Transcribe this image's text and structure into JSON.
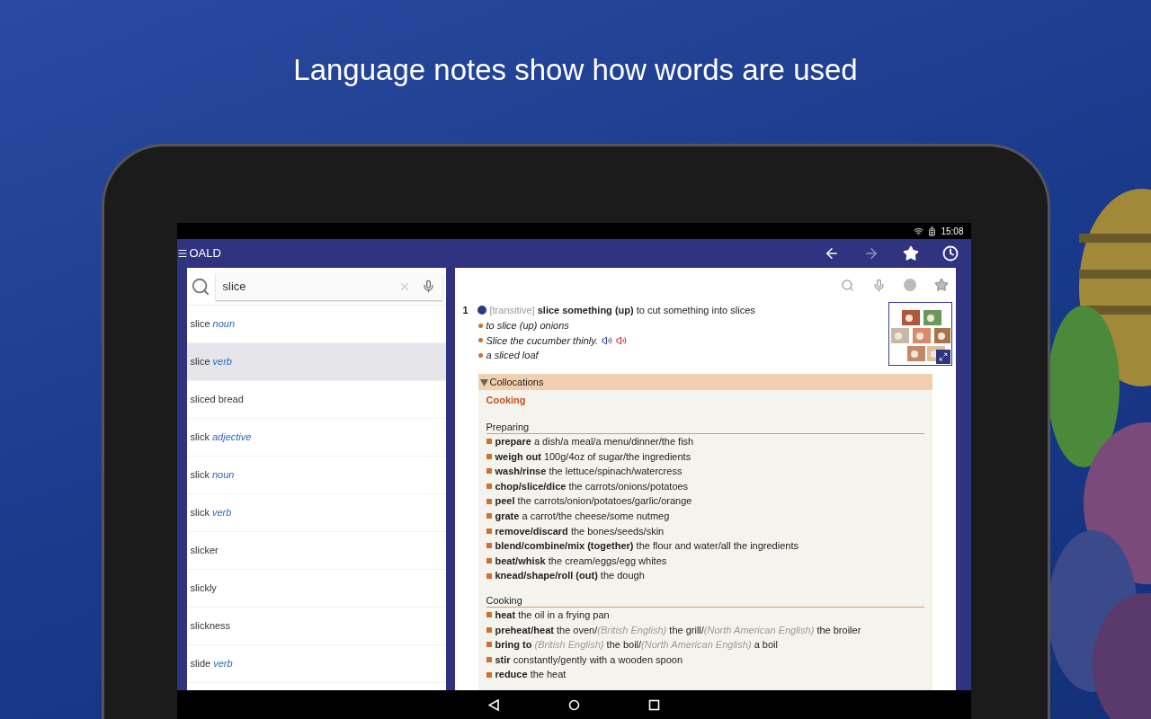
{
  "headline": "Language notes show how words are used",
  "status_bar": {
    "time": "15:08"
  },
  "app_bar": {
    "title": "OALD",
    "actions": [
      {
        "kind": "back",
        "disabled": false
      },
      {
        "kind": "forward",
        "disabled": true
      },
      {
        "kind": "favorites"
      },
      {
        "kind": "history"
      }
    ]
  },
  "search": {
    "value": "slice"
  },
  "results": [
    {
      "word": "slice",
      "pos": "noun",
      "selected": false
    },
    {
      "word": "slice",
      "pos": "verb",
      "selected": true
    },
    {
      "word": "sliced bread",
      "selected": false
    },
    {
      "word": "slick",
      "pos": "adjective",
      "selected": false
    },
    {
      "word": "slick",
      "pos": "noun",
      "selected": false
    },
    {
      "word": "slick",
      "pos": "verb",
      "selected": false
    },
    {
      "word": "slicker",
      "selected": false
    },
    {
      "word": "slickly",
      "selected": false
    },
    {
      "word": "slickness",
      "selected": false
    },
    {
      "word": "slide",
      "pos": "verb",
      "selected": false
    }
  ],
  "entry": {
    "sense_number": "1",
    "grammar": "[transitive]",
    "pattern": "slice something (up)",
    "definition": "to cut something into slices",
    "examples": [
      {
        "text": "to slice (up) onions",
        "audio": false
      },
      {
        "text": "Slice the cucumber thinly.",
        "audio": true
      },
      {
        "text": "a sliced loaf",
        "audio": false
      }
    ],
    "collocations": {
      "title": "Collocations",
      "expanded": true,
      "topic": "Cooking",
      "groups": [
        {
          "heading": "Preparing",
          "lines": [
            [
              {
                "kind": "head",
                "text": "prepare"
              },
              {
                "kind": "plain",
                "text": " a dish/a meal/a menu/dinner/the fish"
              }
            ],
            [
              {
                "kind": "head",
                "text": "weigh out"
              },
              {
                "kind": "plain",
                "text": " 100g/4oz of sugar/the ingredients"
              }
            ],
            [
              {
                "kind": "head",
                "text": "wash/rinse"
              },
              {
                "kind": "plain",
                "text": " the lettuce/spinach/watercress"
              }
            ],
            [
              {
                "kind": "head",
                "text": "chop/slice/dice"
              },
              {
                "kind": "plain",
                "text": " the carrots/onions/potatoes"
              }
            ],
            [
              {
                "kind": "head",
                "text": "peel"
              },
              {
                "kind": "plain",
                "text": " the carrots/onion/potatoes/garlic/orange"
              }
            ],
            [
              {
                "kind": "head",
                "text": "grate"
              },
              {
                "kind": "plain",
                "text": " a carrot/the cheese/some nutmeg"
              }
            ],
            [
              {
                "kind": "head",
                "text": "remove/discard"
              },
              {
                "kind": "plain",
                "text": " the bones/seeds/skin"
              }
            ],
            [
              {
                "kind": "head",
                "text": "blend/combine/mix (together)"
              },
              {
                "kind": "plain",
                "text": " the flour and water/all the ingredients"
              }
            ],
            [
              {
                "kind": "head",
                "text": "beat/whisk"
              },
              {
                "kind": "plain",
                "text": " the cream/eggs/egg whites"
              }
            ],
            [
              {
                "kind": "head",
                "text": "knead/shape/roll (out)"
              },
              {
                "kind": "plain",
                "text": " the dough"
              }
            ]
          ]
        },
        {
          "heading": "Cooking",
          "lines": [
            [
              {
                "kind": "head",
                "text": "heat"
              },
              {
                "kind": "plain",
                "text": " the oil in a frying pan"
              }
            ],
            [
              {
                "kind": "head",
                "text": "preheat/heat"
              },
              {
                "kind": "plain",
                "text": " the oven/"
              },
              {
                "kind": "label",
                "text": "(British English)"
              },
              {
                "kind": "plain",
                "text": " the grill/"
              },
              {
                "kind": "label",
                "text": "(North American English)"
              },
              {
                "kind": "plain",
                "text": " the broiler"
              }
            ],
            [
              {
                "kind": "head",
                "text": "bring to"
              },
              {
                "kind": "label",
                "text": " (British English)"
              },
              {
                "kind": "plain",
                "text": " the boil/"
              },
              {
                "kind": "label",
                "text": "(North American English)"
              },
              {
                "kind": "plain",
                "text": " a boil"
              }
            ],
            [
              {
                "kind": "head",
                "text": "stir"
              },
              {
                "kind": "plain",
                "text": " constantly/gently with a wooden spoon"
              }
            ],
            [
              {
                "kind": "head",
                "text": "reduce"
              },
              {
                "kind": "plain",
                "text": " the heat"
              }
            ]
          ]
        }
      ]
    }
  }
}
